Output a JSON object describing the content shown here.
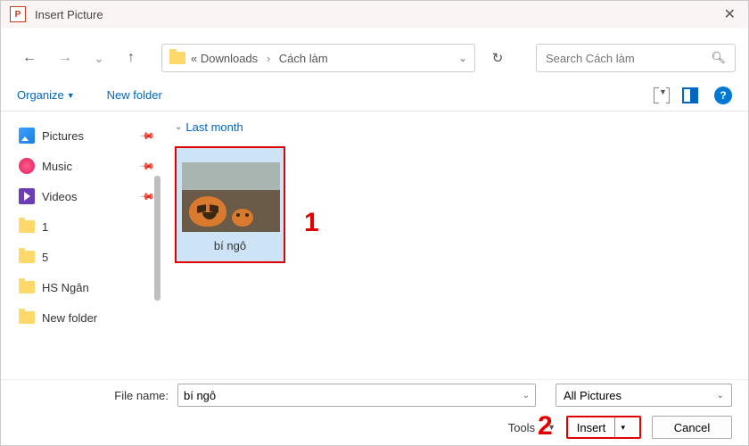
{
  "window": {
    "app_icon_letter": "P",
    "title": "Insert Picture"
  },
  "nav": {
    "breadcrumb_prefix": "«",
    "crumb1": "Downloads",
    "crumb_sep": "›",
    "crumb2": "Cách làm",
    "search_placeholder": "Search Cách làm"
  },
  "toolbar": {
    "organize": "Organize",
    "new_folder": "New folder"
  },
  "sidebar": {
    "items": [
      {
        "label": "Pictures"
      },
      {
        "label": "Music"
      },
      {
        "label": "Videos"
      },
      {
        "label": "1"
      },
      {
        "label": "5"
      },
      {
        "label": "HS Ngân"
      },
      {
        "label": "New folder"
      }
    ]
  },
  "content": {
    "group": "Last month",
    "file_label": "bí ngô"
  },
  "annotations": {
    "a1": "1",
    "a2": "2"
  },
  "footer": {
    "filename_label": "File name:",
    "filename_value": "bí ngô",
    "filter_value": "All Pictures",
    "tools_label": "Tools",
    "insert_label": "Insert",
    "cancel_label": "Cancel"
  }
}
